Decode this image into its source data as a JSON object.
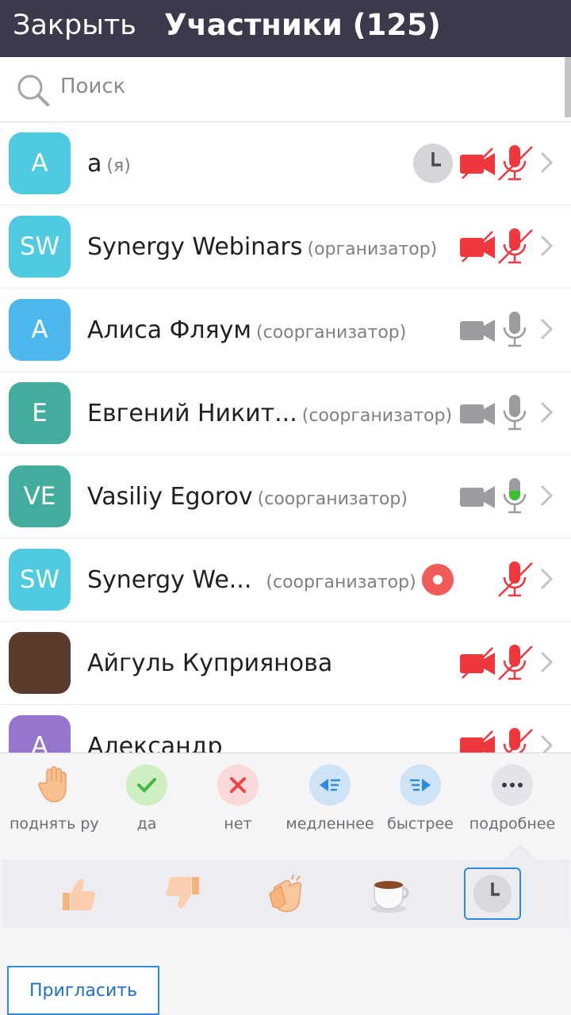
{
  "header": {
    "close_label": "Закрыть",
    "title": "Участники (125)"
  },
  "search": {
    "placeholder": "Поиск"
  },
  "participants": [
    {
      "initials": "A",
      "name": "a",
      "role": "(я)",
      "avatar_color": "#4ecbe0",
      "video": "off",
      "mic": "muted",
      "clock": true
    },
    {
      "initials": "SW",
      "name": "Synergy Webinars",
      "role": "(организатор)",
      "avatar_color": "#4ecbe0",
      "video": "off",
      "mic": "muted"
    },
    {
      "initials": "A",
      "name": "Алиса Фляум",
      "role": "(соорганизатор)",
      "avatar_color": "#4cb8ee",
      "video": "idle",
      "mic": "idle"
    },
    {
      "initials": "E",
      "name": "Евгений Никит...",
      "role": "(соорганизатор)",
      "avatar_color": "#42ad9c",
      "video": "idle",
      "mic": "idle"
    },
    {
      "initials": "VE",
      "name": "Vasiliy Egorov",
      "role": "(соорганизатор)",
      "avatar_color": "#42ad9c",
      "video": "idle",
      "mic": "speaking"
    },
    {
      "initials": "SW",
      "name": "Synergy We...",
      "role": "(соорганизатор)",
      "avatar_color": "#4ecbe0",
      "video": "none",
      "mic": "muted",
      "record": true
    },
    {
      "initials": "",
      "name": "Айгуль Куприянова",
      "role": "",
      "avatar_color": "#5a3b2e",
      "photo": true,
      "video": "off",
      "mic": "muted"
    },
    {
      "initials": "A",
      "name": "Александр",
      "role": "",
      "avatar_color": "#9575cd",
      "video": "off",
      "mic": "muted"
    }
  ],
  "reactions": [
    {
      "icon": "raise-hand-icon",
      "label": "поднять руку"
    },
    {
      "icon": "check-icon",
      "label": "да"
    },
    {
      "icon": "cross-icon",
      "label": "нет"
    },
    {
      "icon": "slower-icon",
      "label": "медленнее"
    },
    {
      "icon": "faster-icon",
      "label": "быстрее"
    },
    {
      "icon": "more-icon",
      "label": "подробнее"
    }
  ],
  "emojis": [
    "thumbs-up-icon",
    "thumbs-down-icon",
    "clapping-hands-icon",
    "coffee-cup-icon",
    "clock-icon"
  ],
  "invite_label": "Пригласить",
  "colors": {
    "header": "#3a3a4c",
    "muted_red": "#f0373d",
    "icon_gray": "#9b9ba0",
    "speaking_green": "#3dbf2f",
    "accent_blue": "#2d8ce0"
  }
}
